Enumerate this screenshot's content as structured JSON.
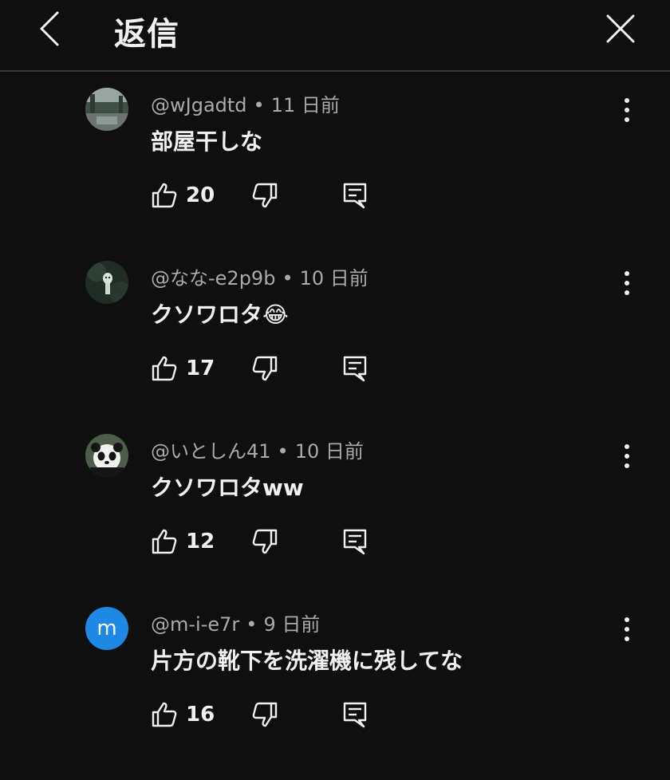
{
  "header": {
    "title": "返信"
  },
  "comments": [
    {
      "author": "@wJgadtd",
      "time": "11 日前",
      "text": "部屋干しな",
      "likes": "20",
      "avatar": "landscape-photo"
    },
    {
      "author": "@なな-e2p9b",
      "time": "10 日前",
      "text": "クソワロタ😂",
      "likes": "17",
      "avatar": "forest-spirit-photo"
    },
    {
      "author": "@いとしん41",
      "time": "10 日前",
      "text": "クソワロタww",
      "likes": "12",
      "avatar": "panda-photo"
    },
    {
      "author": "@m-i-e7r",
      "time": "9 日前",
      "text": "片方の靴下を洗濯機に残してな",
      "likes": "16",
      "avatar_letter": "m"
    }
  ],
  "colors": {
    "background": "#0f0f0f",
    "text": "#f1f1f1",
    "meta": "#aaaaaa",
    "avatar_letter_bg": "#1e88e5"
  }
}
